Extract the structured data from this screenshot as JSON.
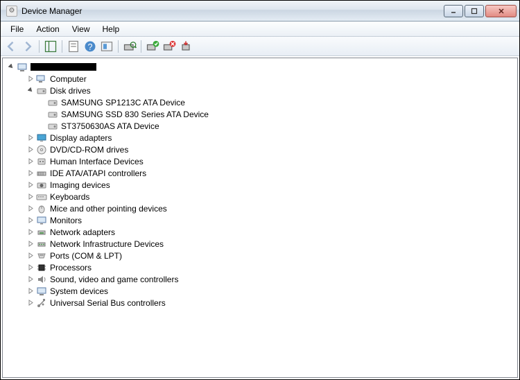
{
  "window": {
    "title": "Device Manager"
  },
  "menu": {
    "file": "File",
    "action": "Action",
    "view": "View",
    "help": "Help"
  },
  "tree": {
    "root": "[redacted]",
    "computer": "Computer",
    "disk_drives": "Disk drives",
    "drive1": "SAMSUNG SP1213C ATA Device",
    "drive2": "SAMSUNG SSD 830 Series ATA Device",
    "drive3": "ST3750630AS ATA Device",
    "display": "Display adapters",
    "dvd": "DVD/CD-ROM drives",
    "hid": "Human Interface Devices",
    "ide": "IDE ATA/ATAPI controllers",
    "imaging": "Imaging devices",
    "keyboards": "Keyboards",
    "mice": "Mice and other pointing devices",
    "monitors": "Monitors",
    "network": "Network adapters",
    "netinfra": "Network Infrastructure Devices",
    "ports": "Ports (COM & LPT)",
    "processors": "Processors",
    "sound": "Sound, video and game controllers",
    "system": "System devices",
    "usb": "Universal Serial Bus controllers"
  }
}
